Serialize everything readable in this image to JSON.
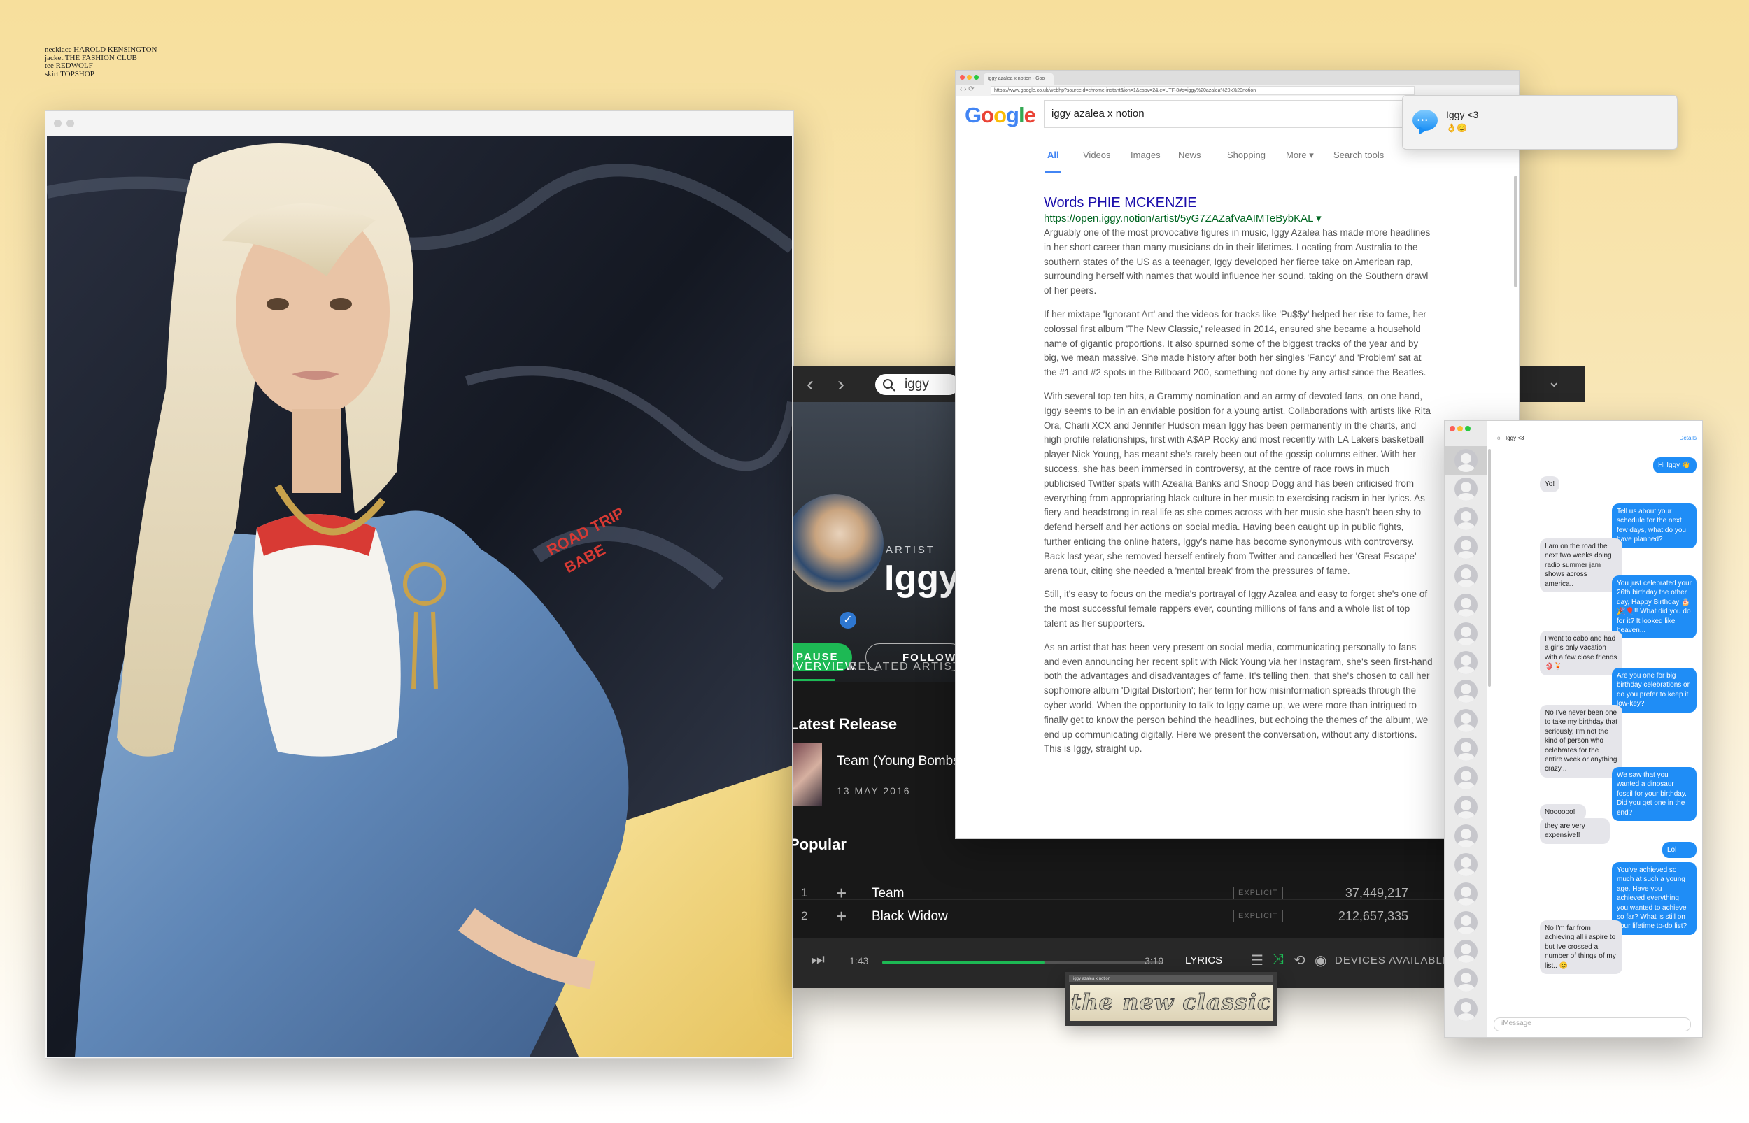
{
  "credits": [
    "necklace HAROLD KENSINGTON",
    "jacket THE FASHION CLUB",
    "tee REDWOLF",
    "skirt TOPSHOP"
  ],
  "photo": {
    "tee_text": "ROAD TRIP BABE"
  },
  "spotify": {
    "search_value": "iggy",
    "artist_label": "ARTIST",
    "artist_name": "Iggy",
    "pause_label": "PAUSE",
    "follow_label": "FOLLOW",
    "tabs": [
      "OVERVIEW",
      "RELATED ARTISTS"
    ],
    "latest_release_heading": "Latest Release",
    "latest_release": {
      "title": "Team (Young Bombs Remix)",
      "date": "13 MAY 2016"
    },
    "popular_heading": "Popular",
    "tracks": [
      {
        "num": "1",
        "name": "Team",
        "explicit": "EXPLICIT",
        "plays": "37,449,217"
      },
      {
        "num": "2",
        "name": "Black Widow",
        "explicit": "EXPLICIT",
        "plays": "212,657,335"
      }
    ],
    "player": {
      "elapsed": "1:43",
      "duration": "3:19",
      "progress": 0.58,
      "lyrics": "LYRICS",
      "devices": "DEVICES AVAILABLE"
    }
  },
  "google": {
    "tab_title": "iggy azalea x notion - Goo",
    "url": "https://www.google.co.uk/webhp?sourceid=chrome-instant&ion=1&espv=2&ie=UTF-8#q=iggy%20azalea%20x%20notion",
    "query": "iggy azalea x notion",
    "nav": [
      "All",
      "Videos",
      "Images",
      "News",
      "Shopping",
      "More ▾",
      "Search tools"
    ],
    "result_title": "Words PHIE MCKENZIE",
    "result_url": "https://open.iggy.notion/artist/5yG7ZAZafVaAIMTeBybKAL ▾",
    "paragraphs": [
      "Arguably one of the most provocative figures in music, Iggy Azalea has made more headlines in her short career than many musicians do in their lifetimes. Locating from Australia to the southern states of the US as a teenager, Iggy developed her fierce take on American rap, surrounding herself with names that would influence her sound, taking on the Southern drawl of her peers.",
      "If her mixtape 'Ignorant Art' and the videos for tracks like 'Pu$$y' helped her rise to fame, her colossal first album 'The New Classic,' released in 2014, ensured she became a household name of gigantic proportions. It also spurned some of the biggest tracks of the year and by big, we mean massive. She made history after both her singles 'Fancy' and 'Problem' sat at the #1 and #2 spots in the Billboard 200, something not done by any artist since the Beatles.",
      "With several top ten hits, a Grammy nomination and an army of devoted fans, on one hand, Iggy seems to be in an enviable position for a young artist. Collaborations with artists like Rita Ora, Charli XCX and Jennifer Hudson mean Iggy has been permanently in the charts, and high profile relationships, first with A$AP Rocky and most recently with LA Lakers basketball player Nick Young, has meant she's rarely been out of the gossip columns either. With her success, she has been immersed in controversy, at the centre of race rows in much publicised Twitter spats with Azealia Banks and Snoop Dogg and has been criticised from everything from appropriating black culture in her music to exercising racism in her lyrics. As fiery and headstrong in real life as she comes across with her music she hasn't been shy to defend herself and her actions on social media. Having been caught up in public fights, further enticing the online haters, Iggy's name has become synonymous with controversy. Back last year, she removed herself entirely from Twitter and cancelled her 'Great Escape' arena tour, citing she needed a 'mental break' from the pressures of fame.",
      "Still, it's easy to focus on the media's portrayal of Iggy Azalea and easy to forget she's one of the most successful female rappers ever, counting millions of fans and a whole list of top talent as her supporters.",
      "As an artist that has been very present on social media, communicating personally to fans and even announcing her recent split with Nick Young via her Instagram, she's seen first-hand both the advantages and disadvantages of fame. It's telling then, that she's chosen to call her sophomore album 'Digital Distortion'; her term for how misinformation spreads through the cyber world. When the opportunity to talk to Iggy came up, we were more than intrigued to finally get to know the person behind the headlines, but echoing the themes of the album, we end up communicating digitally. Here we present the conversation, without any distortions. This is Iggy, straight up."
    ]
  },
  "notification": {
    "from": "Iggy <3",
    "message": "👌😊"
  },
  "badge": {
    "strip": "iggy azalea x notion",
    "text": "the new classic"
  },
  "imessage": {
    "to_label": "To:",
    "to_name": "Iggy <3",
    "details": "Details",
    "input_placeholder": "iMessage",
    "messages": [
      {
        "dir": "out",
        "text": "Hi Iggy 👋"
      },
      {
        "dir": "in",
        "text": "Yo!"
      },
      {
        "dir": "out",
        "text": "Tell us about your schedule for the next few days, what do you have planned?"
      },
      {
        "dir": "in",
        "text": "I am on the road the next two weeks doing radio summer jam shows across america.."
      },
      {
        "dir": "out",
        "text": "You just celebrated your 26th birthday the other day, Happy Birthday 🎂🎉🎈!! What did you do for it? It looked like heaven..."
      },
      {
        "dir": "in",
        "text": "I went to cabo and had a girls only vacation with a few close friends 👙🍹"
      },
      {
        "dir": "out",
        "text": "Are you one for big birthday celebrations or do you prefer to keep it low-key?"
      },
      {
        "dir": "in",
        "text": "No I've never been one to take my birthday that seriously, I'm not the kind of person who celebrates for the entire week or anything crazy..."
      },
      {
        "dir": "out",
        "text": "We saw that you wanted a dinosaur fossil for your birthday. Did you get one in the end?"
      },
      {
        "dir": "in",
        "text": "Noooooo!"
      },
      {
        "dir": "in",
        "text": "they are very expensive!!"
      },
      {
        "dir": "out",
        "text": "Lol"
      },
      {
        "dir": "out",
        "text": "You've achieved so much at such a young age. Have you achieved everything you wanted to achieve so far? What is still on your lifetime to-do list?"
      },
      {
        "dir": "in",
        "text": "No I'm far from achieving all i aspire to but Ive crossed a number of things of my list.. 😊"
      }
    ]
  }
}
